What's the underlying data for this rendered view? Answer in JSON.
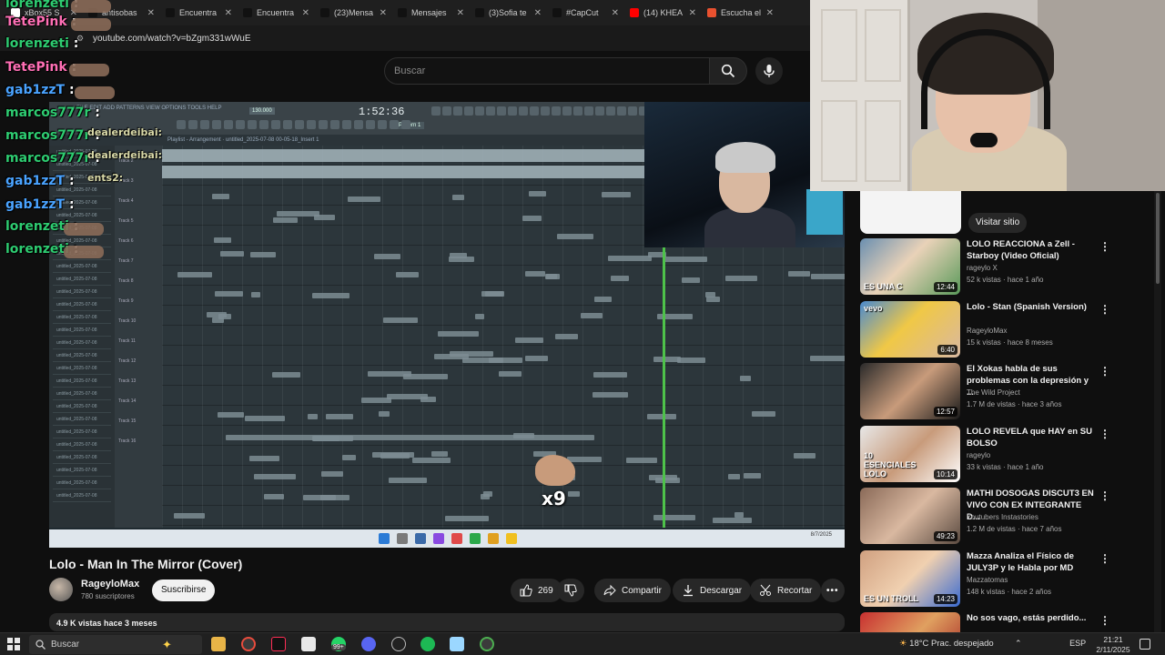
{
  "browser": {
    "tabs": [
      {
        "label": "xBox55 S",
        "color": "#ffffff"
      },
      {
        "label": "antisobas",
        "color": "#111111"
      },
      {
        "label": "Encuentra",
        "color": "#111111"
      },
      {
        "label": "Encuentra",
        "color": "#111111"
      },
      {
        "label": "(23)Mensa",
        "color": "#111111"
      },
      {
        "label": "Mensajes",
        "color": "#111111"
      },
      {
        "label": "(3)Sofia te",
        "color": "#111111"
      },
      {
        "label": "#CapCut",
        "color": "#111111"
      },
      {
        "label": "(14) KHEA",
        "color": "#ff0000"
      },
      {
        "label": "Escucha el",
        "color": "#e9512f"
      }
    ],
    "url": "youtube.com/watch?v=bZgm331wWuE"
  },
  "youtube": {
    "search_placeholder": "Buscar",
    "video": {
      "title": "Lolo - Man In The Mirror (Cover)",
      "channel": "RageyloMax",
      "subscribers": "780 suscriptores",
      "subscribe_label": "Suscribirse",
      "likes": "269",
      "share_label": "Compartir",
      "download_label": "Descargar",
      "clip_label": "Recortar",
      "description_meta": "4.9 K vistas  hace 3 meses"
    },
    "sidebar": {
      "visit_site_label": "Visitar sitio",
      "recommendations": [
        {
          "title": "LOLO REACCIONA a Zell - Starboy (Video Oficial)",
          "channel": "rageylo X",
          "meta": "52 k vistas · hace 1 año",
          "duration": "12:44",
          "overlay": "ES UNA C"
        },
        {
          "title": "Lolo - Stan (Spanish Version)",
          "channel": "RageyloMax",
          "meta": "15 k vistas · hace 8 meses",
          "duration": "6:40",
          "overlay": "vevo"
        },
        {
          "title": "El Xokas habla de sus problemas con la depresión y ...",
          "channel": "The Wild Project",
          "meta": "1.7 M de vistas · hace 3 años",
          "duration": "12:57",
          "overlay": ""
        },
        {
          "title": "LOLO REVELA que HAY en SU BOLSO",
          "channel": "rageylo",
          "meta": "33 k vistas · hace 1 año",
          "duration": "10:14",
          "overlay": "10 ESENCIALES LOLO"
        },
        {
          "title": "MATHI DOSOGAS DISCUT3 EN VIVO CON EX INTEGRANTE D...",
          "channel": "Youtubers Instastories",
          "meta": "1.2 M de vistas · hace 7 años",
          "duration": "49:23",
          "overlay": ""
        },
        {
          "title": "Mazza Analiza el Físico de JULY3P y le Habla por MD",
          "channel": "Mazzatomas",
          "meta": "148 k vistas · hace 2 años",
          "duration": "14:23",
          "overlay": "ES UN TROLL"
        },
        {
          "title": "No sos vago, estás perdido...",
          "channel": "Franco Risso",
          "meta": "",
          "duration": "",
          "overlay": ""
        }
      ]
    }
  },
  "stream": {
    "chat": [
      {
        "user": "lorenzeti",
        "color": "#2ecc71"
      },
      {
        "user": "TetePink",
        "color": "#ff6fb5"
      },
      {
        "user": "lorenzeti",
        "color": "#2ecc71"
      },
      {
        "user": "TetePink",
        "color": "#ff6fb5"
      },
      {
        "user": "gab1zzT",
        "color": "#4aa3ff"
      },
      {
        "user": "marcos777r",
        "color": "#2ecc71"
      },
      {
        "user": "marcos777r",
        "color": "#2ecc71"
      },
      {
        "user": "marcos777r",
        "color": "#2ecc71"
      },
      {
        "user": "gab1zzT",
        "color": "#4aa3ff"
      },
      {
        "user": "gab1zzT",
        "color": "#4aa3ff"
      },
      {
        "user": "lorenzeti",
        "color": "#2ecc71"
      },
      {
        "user": "lorenzeti",
        "color": "#2ecc71"
      }
    ],
    "inner_chat_names": [
      "dealerdeibai:",
      "dealerdeibai:",
      "ents2:"
    ],
    "emote_combo": "x9"
  },
  "fl_studio": {
    "time_display": "1:52:36",
    "tempo": "130.000",
    "pattern": "Pattern 1",
    "playlist_title": "Playlist - Arrangement · untitled_2025-07-08 00-05-18_Insert 1",
    "tracks": [
      "Track 2",
      "Track 3",
      "Track 4",
      "Track 5",
      "Track 6",
      "Track 7",
      "Track 8",
      "Track 9",
      "Track 10",
      "Track 11",
      "Track 12",
      "Track 13",
      "Track 14",
      "Track 15",
      "Track 16"
    ],
    "tray_date": "8/7/2025"
  },
  "taskbar": {
    "search_placeholder": "Buscar",
    "weather": "18°C  Prac. despejado",
    "language": "ESP",
    "time": "21:21",
    "date": "2/11/2025",
    "whatsapp_badge": "99+"
  }
}
